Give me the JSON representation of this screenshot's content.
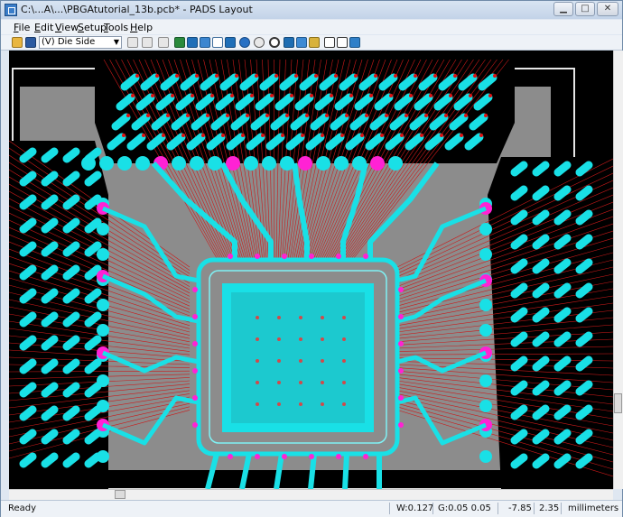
{
  "window": {
    "title": "C:\\...A\\...\\PBGAtutorial_13b.pcb* - PADS Layout",
    "controls": [
      "minimize",
      "maximize",
      "close"
    ]
  },
  "menu": {
    "items": [
      "File",
      "Edit",
      "View",
      "Setup",
      "Tools",
      "Help"
    ]
  },
  "toolbar": {
    "layer_select_value": "(V) Die Side",
    "icons": [
      "open-icon",
      "save-icon",
      "layer-select",
      "redraw-icon",
      "undo-icon",
      "route-icon",
      "cluster-icon",
      "pin-icon",
      "view-icon",
      "bus-icon",
      "rotate-icon",
      "redo-icon",
      "help-icon",
      "zoom-icon",
      "verify-icon",
      "flag-icon",
      "filter-icon",
      "window-icon",
      "tile-icon",
      "layout-icon"
    ]
  },
  "canvas": {
    "background": "#000000",
    "board_fill": "#8c8c8c",
    "pad_color": "#19e0e6",
    "via_color": "#ff22d4",
    "ratsnest_color": "#cc1a1a",
    "trace_color": "#19e0e6"
  },
  "status": {
    "ready": "Ready",
    "width": "W:0.127",
    "grid": "G:0.05 0.05",
    "x": "-7.85",
    "y": "2.35",
    "units": "millimeters"
  }
}
